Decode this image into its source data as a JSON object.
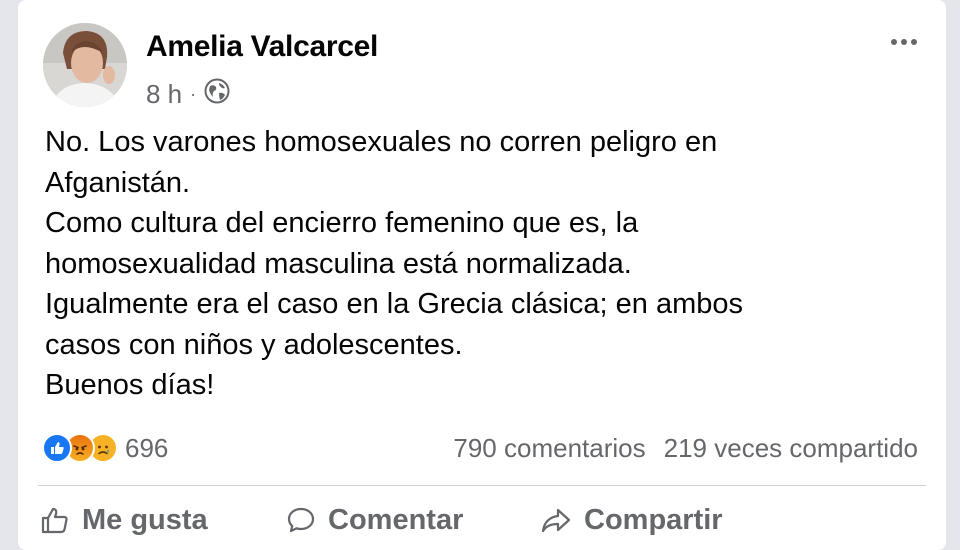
{
  "post": {
    "author": "Amelia Valcarcel",
    "time": "8 h",
    "separator": "·",
    "privacy_icon": "globe-icon",
    "lines": [
      "No.  Los varones  homosexuales no corren peligro en",
      "Afganistán.",
      "Como cultura del encierro femenino que es, la",
      "homosexualidad masculina está normalizada.",
      "Igualmente era el caso en la Grecia clásica; en ambos",
      "casos con niños y adolescentes.",
      "Buenos días!"
    ]
  },
  "reactions": {
    "icons": [
      "like-reaction-icon",
      "angry-reaction-icon",
      "sad-reaction-icon"
    ],
    "count": "696"
  },
  "stats": {
    "comments": "790 comentarios",
    "shares": "219 veces compartido"
  },
  "actions": {
    "like": "Me gusta",
    "comment": "Comentar",
    "share": "Compartir"
  },
  "colors": {
    "background": "#e4e6eb",
    "card": "#ffffff",
    "text": "#050505",
    "secondary_text": "#65676b",
    "like_blue": "#1877f2",
    "reaction_yellow": "#f7b125",
    "angry_orange": "#e9710f"
  }
}
